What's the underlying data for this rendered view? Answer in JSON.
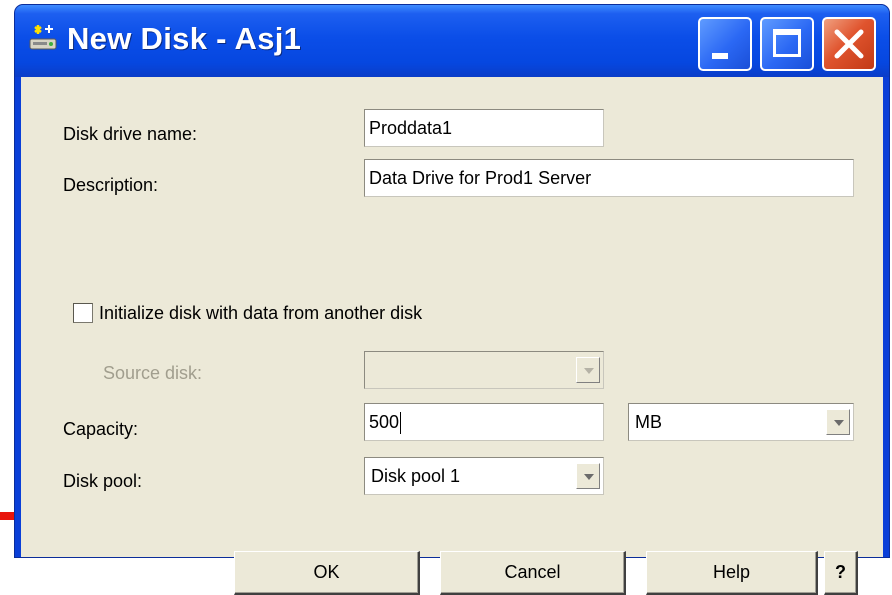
{
  "window": {
    "title": "New Disk - Asj1"
  },
  "titlebar": {
    "minimize_icon": "minimize-icon",
    "maximize_icon": "maximize-icon",
    "close_icon": "close-icon"
  },
  "form": {
    "disk_name": {
      "label": "Disk drive name:",
      "value": "Proddata1"
    },
    "description": {
      "label": "Description:",
      "value": "Data Drive for Prod1 Server"
    },
    "initialize": {
      "label": "Initialize disk with data from another disk",
      "checked": false
    },
    "source_disk": {
      "label": "Source disk:",
      "value": "",
      "enabled": false
    },
    "capacity": {
      "label": "Capacity:",
      "value": "500",
      "unit": "MB"
    },
    "disk_pool": {
      "label": "Disk pool:",
      "value": "Disk pool 1"
    }
  },
  "buttons": {
    "ok": "OK",
    "cancel": "Cancel",
    "help": "Help",
    "whats_this": "?"
  },
  "colors": {
    "titlebar": "#0b4ee8",
    "dialog_bg": "#ece9d8",
    "close_button": "#e0542e",
    "stray_line": "#e8150c"
  }
}
